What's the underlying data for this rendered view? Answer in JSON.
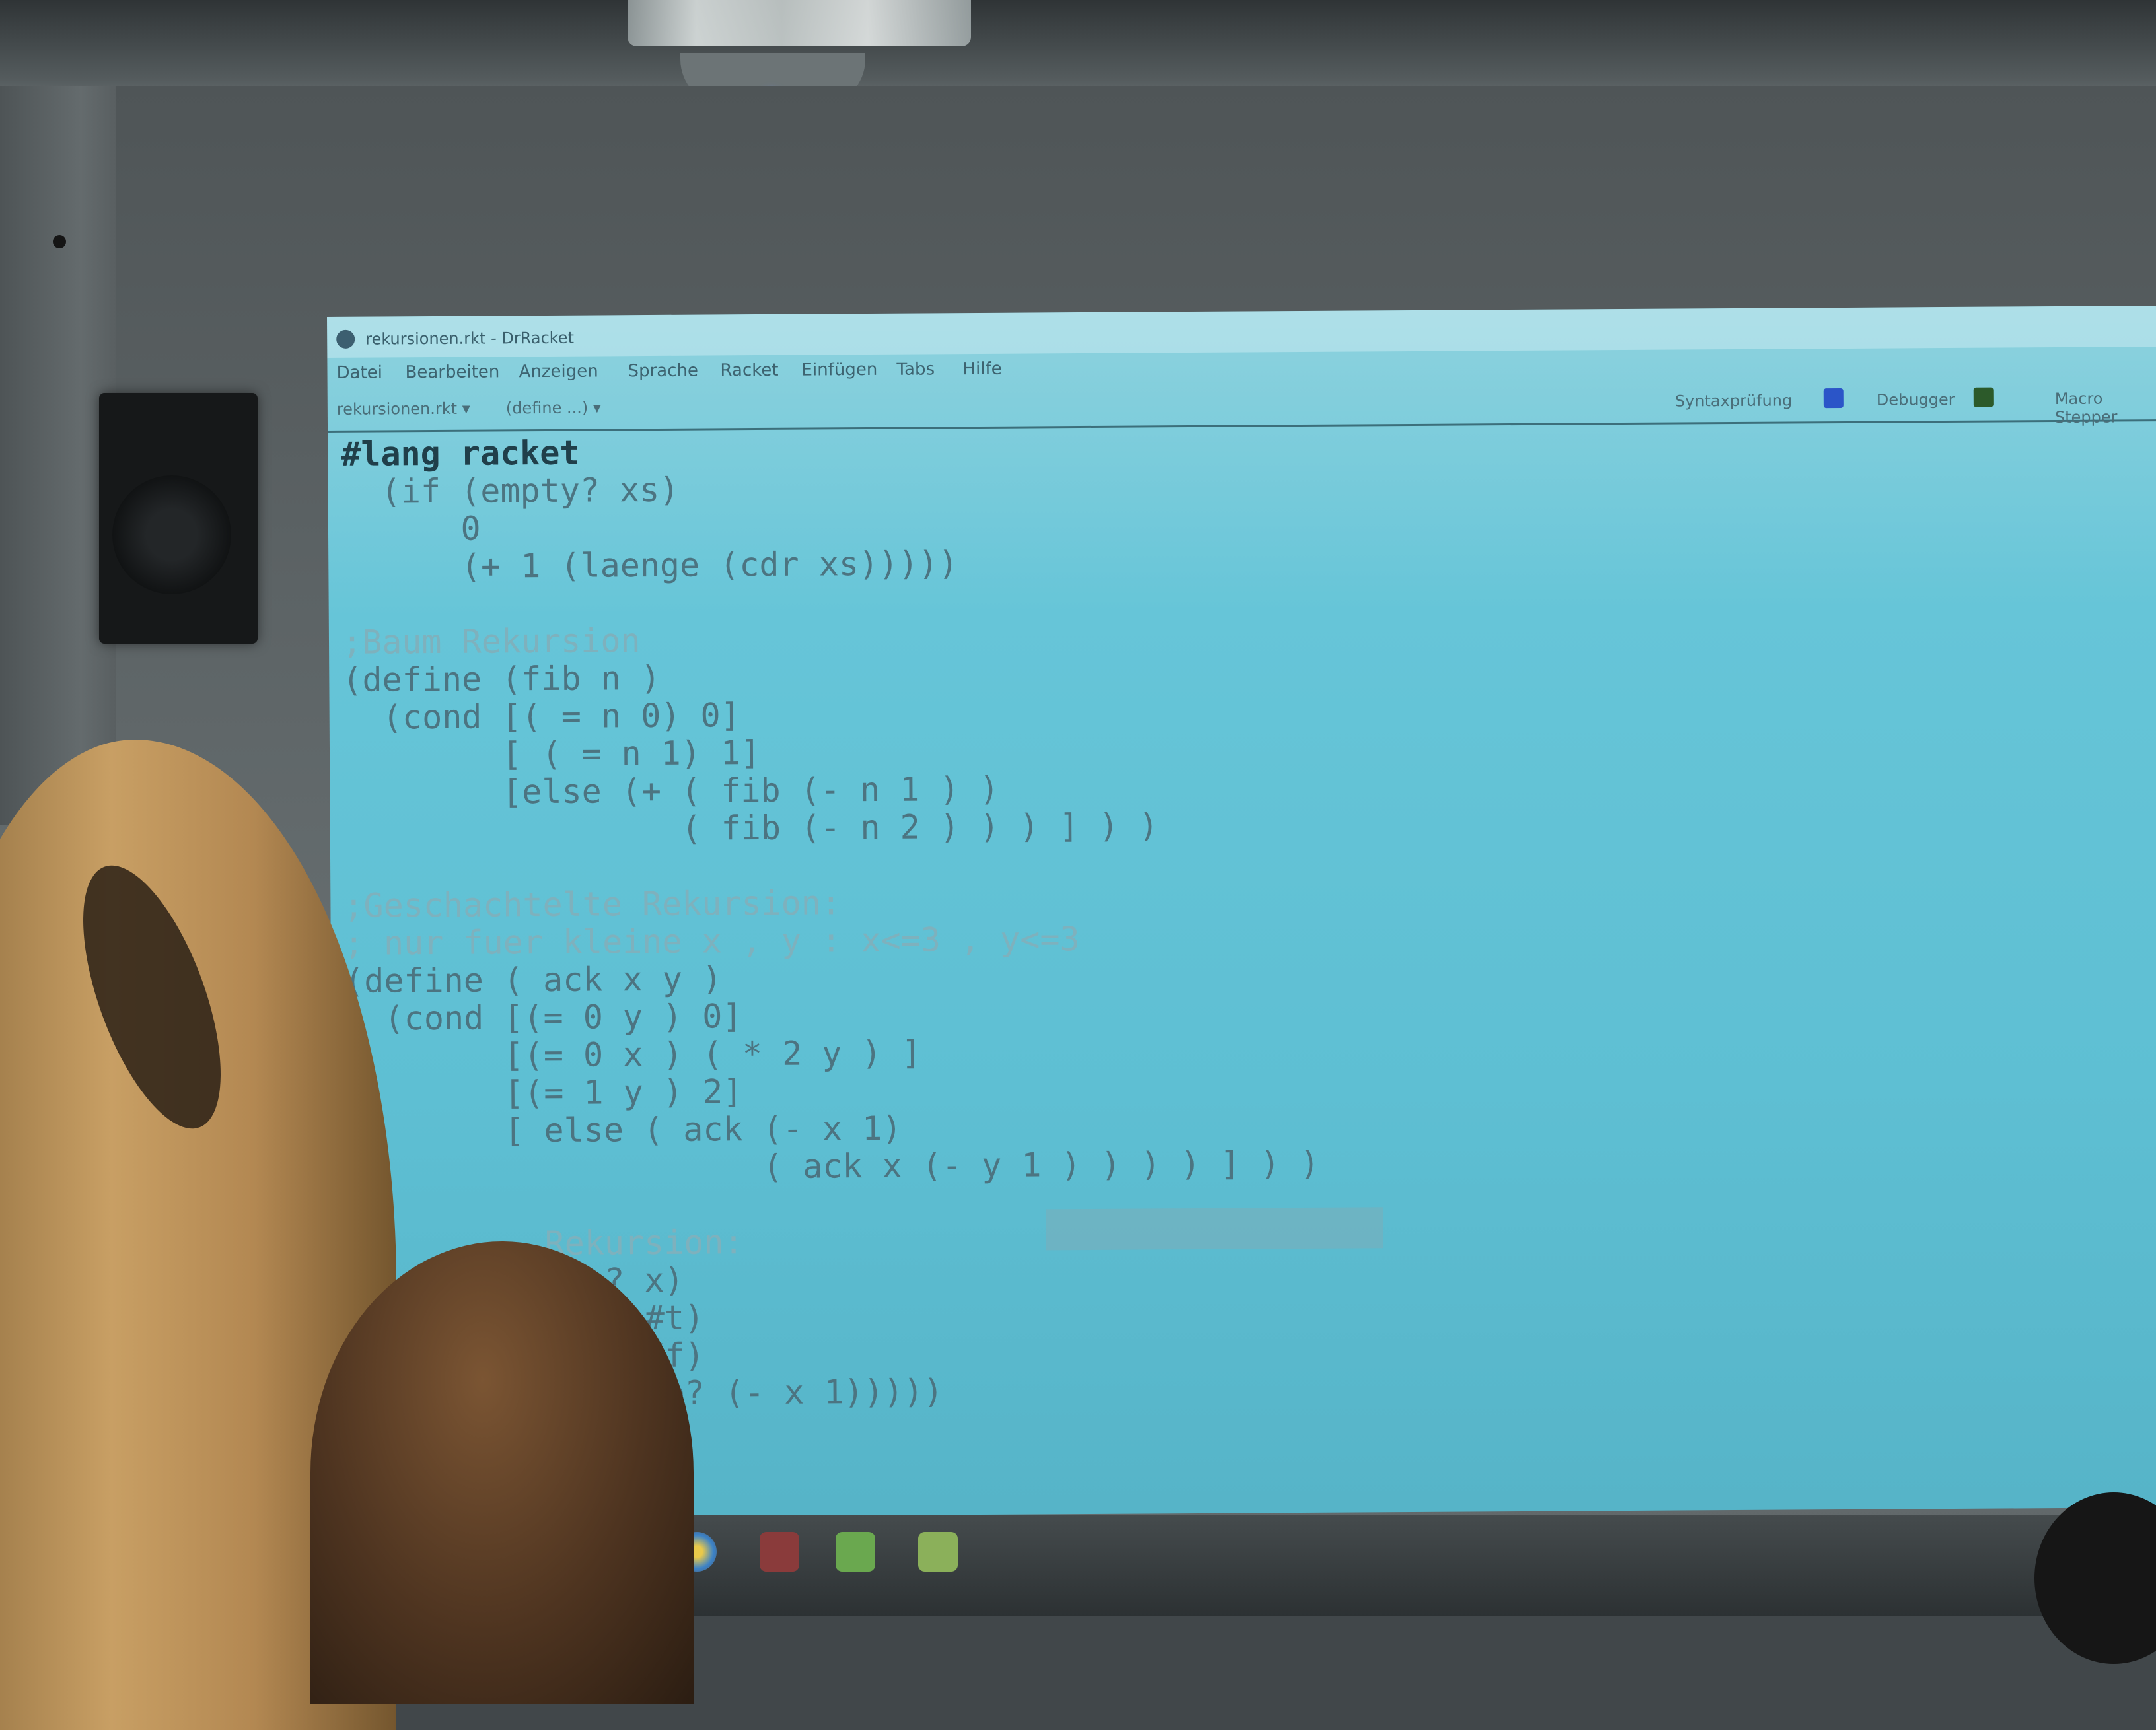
{
  "window": {
    "title": "rekursionen.rkt - DrRacket",
    "menu": [
      "Datei",
      "Bearbeiten",
      "Anzeigen",
      "Sprache",
      "Racket",
      "Einfügen",
      "Tabs",
      "Hilfe"
    ],
    "file_dropdown": "rekursionen.rkt ▾",
    "define_dropdown": "(define ...) ▾",
    "toolbar": {
      "syntax_check": "Syntaxprüfung",
      "debugger": "Debugger",
      "macro_stepper": "Macro Stepper"
    }
  },
  "code": [
    {
      "text": "#lang racket",
      "kind": "lang"
    },
    {
      "text": "  (if (empty? xs)",
      "kind": "code"
    },
    {
      "text": "      0",
      "kind": "code"
    },
    {
      "text": "      (+ 1 (laenge (cdr xs)))))",
      "kind": "code"
    },
    {
      "text": "",
      "kind": "code"
    },
    {
      "text": ";Baum Rekursion",
      "kind": "comment"
    },
    {
      "text": "(define (fib n )",
      "kind": "code"
    },
    {
      "text": "  (cond [( = n 0) 0]",
      "kind": "code"
    },
    {
      "text": "        [ ( = n 1) 1]",
      "kind": "code"
    },
    {
      "text": "        [else (+ ( fib (- n 1 ) )",
      "kind": "code"
    },
    {
      "text": "                 ( fib (- n 2 ) ) ) ] ) )",
      "kind": "code"
    },
    {
      "text": "",
      "kind": "code"
    },
    {
      "text": ";Geschachtelte Rekursion:",
      "kind": "comment"
    },
    {
      "text": "; nur fuer kleine x , y : x<=3 , y<=3",
      "kind": "comment"
    },
    {
      "text": "(define ( ack x y )",
      "kind": "code"
    },
    {
      "text": "  (cond [(= 0 y ) 0]",
      "kind": "code"
    },
    {
      "text": "        [(= 0 x ) ( * 2 y ) ]",
      "kind": "code"
    },
    {
      "text": "        [(= 1 y ) 2]",
      "kind": "code"
    },
    {
      "text": "        [ else ( ack (- x 1)",
      "kind": "code"
    },
    {
      "text": "                     ( ack x (- y 1 ) ) ) ) ] ) )",
      "kind": "code"
    },
    {
      "text": "",
      "kind": "code"
    },
    {
      "text": "          Rekursion:",
      "kind": "comment"
    },
    {
      "text": "          ade? x)",
      "kind": "code"
    },
    {
      "text": "            2] #t)",
      "kind": "code"
    },
    {
      "text": "            2] #f)",
      "kind": "code"
    },
    {
      "text": "          ngerade? (- x 1)))))",
      "kind": "code"
    }
  ]
}
